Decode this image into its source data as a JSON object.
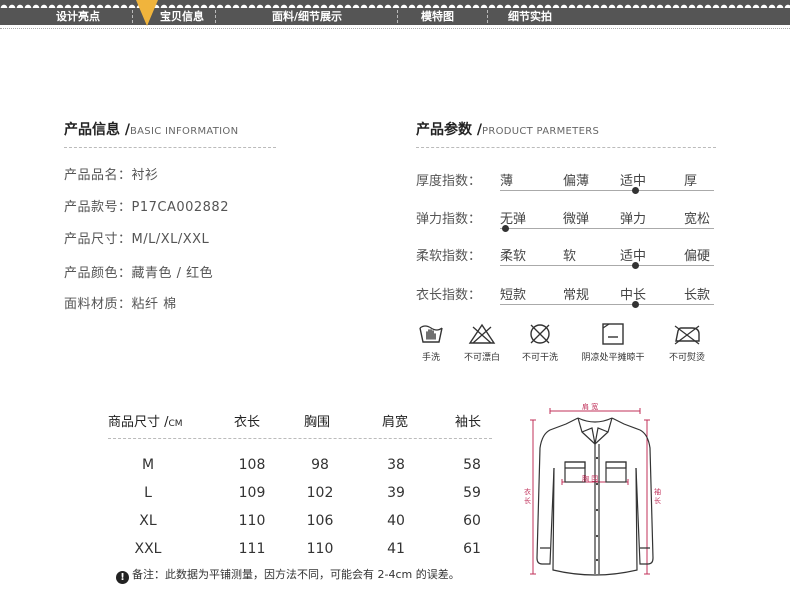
{
  "nav": {
    "items": [
      "设计亮点",
      "宝贝信息",
      "面料/细节展示",
      "模特图",
      "细节实拍"
    ],
    "active": "宝贝信息"
  },
  "basic_info": {
    "title": "产品信息 /",
    "title_en": "BASIC INFORMATION",
    "rows": [
      "产品品名：衬衫",
      "产品款号：P17CA002882",
      "产品尺寸：M/L/XL/XXL",
      "产品颜色：藏青色 / 红色",
      "面料材质：粘纤 棉"
    ]
  },
  "product_params": {
    "title": "产品参数 /",
    "title_en": "PRODUCT PARMETERS",
    "rows": [
      {
        "label": "厚度指数：",
        "options": [
          "薄",
          "偏薄",
          "适中",
          "厚"
        ],
        "selected": 2
      },
      {
        "label": "弹力指数：",
        "options": [
          "无弹",
          "微弹",
          "弹力",
          "宽松"
        ],
        "selected": 0
      },
      {
        "label": "柔软指数：",
        "options": [
          "柔软",
          "软",
          "适中",
          "偏硬"
        ],
        "selected": 2
      },
      {
        "label": "衣长指数：",
        "options": [
          "短款",
          "常规",
          "中长",
          "长款"
        ],
        "selected": 2
      }
    ]
  },
  "care": [
    {
      "icon": "hand-wash-icon",
      "label": "手洗"
    },
    {
      "icon": "no-bleach-icon",
      "label": "不可漂白"
    },
    {
      "icon": "no-tumble-dry-icon",
      "label": "不可干洗"
    },
    {
      "icon": "dry-flat-shade-icon",
      "label": "阴凉处平摊晾干"
    },
    {
      "icon": "no-iron-icon",
      "label": "不可熨烫"
    }
  ],
  "size_table": {
    "title": "商品尺寸 /",
    "unit": "CM",
    "headers": [
      "衣长",
      "胸围",
      "肩宽",
      "袖长"
    ],
    "rows": [
      {
        "size": "M",
        "values": [
          "108",
          "98",
          "38",
          "58"
        ]
      },
      {
        "size": "L",
        "values": [
          "109",
          "102",
          "39",
          "59"
        ]
      },
      {
        "size": "XL",
        "values": [
          "110",
          "106",
          "40",
          "60"
        ]
      },
      {
        "size": "XXL",
        "values": [
          "111",
          "110",
          "41",
          "61"
        ]
      }
    ],
    "note_icon": "!",
    "note": "备注：此数据为平铺测量，因方法不同，可能会有 2-4cm 的误差。"
  },
  "diagram": {
    "shoulder": "肩 宽",
    "chest": "胸 围",
    "length": "衣 长",
    "sleeve": "袖 长",
    "accent": "#c0305a"
  }
}
